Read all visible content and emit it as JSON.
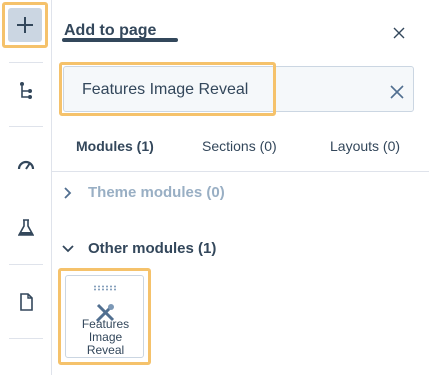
{
  "rail": {
    "items": [
      {
        "name": "add",
        "icon": "plus-icon"
      },
      {
        "name": "tree",
        "icon": "tree-structure-icon"
      },
      {
        "name": "performance",
        "icon": "speedometer-icon"
      },
      {
        "name": "test",
        "icon": "flask-icon"
      },
      {
        "name": "page",
        "icon": "document-icon"
      }
    ],
    "add_highlight_color": "#f5c26b",
    "add_bg_color": "#cbd6e2"
  },
  "panel": {
    "title": "Add to page",
    "close_icon": "close-icon"
  },
  "search": {
    "value": "Features Image Reveal",
    "clear_icon": "clear-icon"
  },
  "tabs": [
    {
      "label": "Modules (1)",
      "active": true
    },
    {
      "label": "Sections (0)",
      "active": false
    },
    {
      "label": "Layouts (0)",
      "active": false
    }
  ],
  "sections": {
    "theme": {
      "label": "Theme modules (0)",
      "expanded": false
    },
    "other": {
      "label": "Other modules (1)",
      "expanded": true
    }
  },
  "modules": [
    {
      "label": "Features Image Reveal",
      "label_lines": [
        "Features",
        "Image",
        "Reveal"
      ],
      "icon": "tools-icon"
    }
  ],
  "colors": {
    "text": "#33475b",
    "muted": "#99afc4",
    "border": "#cbd6e2",
    "highlight": "#f5c26b"
  }
}
